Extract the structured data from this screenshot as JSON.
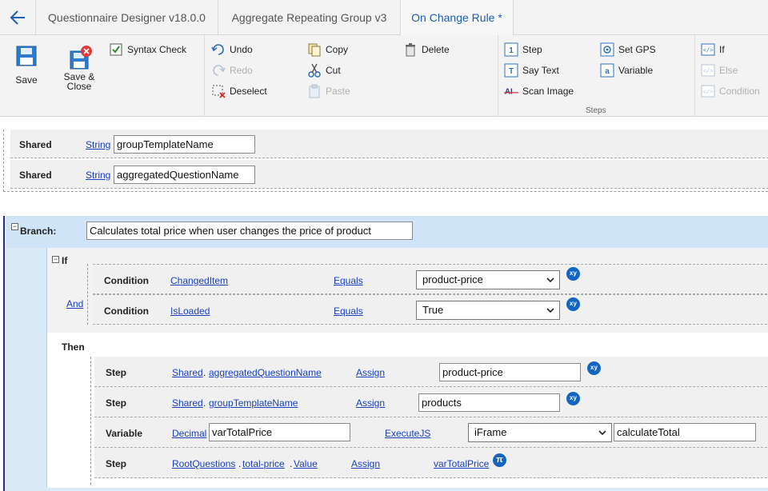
{
  "tabs": [
    {
      "label": "Questionnaire Designer v18.0.0"
    },
    {
      "label": "Aggregate Repeating  Group v3"
    },
    {
      "label": "On Change Rule *"
    }
  ],
  "ribbon": {
    "save": "Save",
    "save_close": "Save & Close",
    "syntax_check": "Syntax Check",
    "undo": "Undo",
    "redo": "Redo",
    "deselect": "Deselect",
    "copy": "Copy",
    "cut": "Cut",
    "paste": "Paste",
    "delete": "Delete",
    "step": "Step",
    "say_text": "Say Text",
    "scan_image": "Scan Image",
    "set_gps": "Set GPS",
    "variable": "Variable",
    "steps_group": "Steps",
    "if": "If",
    "else": "Else",
    "condition": "Condition"
  },
  "shared_rows": [
    {
      "keyword": "Shared",
      "type": "String",
      "name": "groupTemplateName"
    },
    {
      "keyword": "Shared",
      "type": "String",
      "name": "aggregatedQuestionName"
    }
  ],
  "branch": {
    "label": "Branch:",
    "description": "Calculates total price when user changes the price of product",
    "if_label": "If",
    "and_label": "And",
    "then_label": "Then",
    "conditions": [
      {
        "keyword": "Condition",
        "field": "ChangedItem",
        "operator": "Equals",
        "value": "product-price"
      },
      {
        "keyword": "Condition",
        "field": "IsLoaded",
        "operator": "Equals",
        "value": "True"
      }
    ],
    "steps": [
      {
        "keyword": "Step",
        "scope": "Shared",
        "dot": ".",
        "target": "aggregatedQuestionName",
        "action": "Assign",
        "value": "product-price"
      },
      {
        "keyword": "Step",
        "scope": "Shared",
        "dot": ".",
        "target": "groupTemplateName",
        "action": "Assign",
        "value": "products"
      },
      {
        "keyword": "Variable",
        "type": "Decimal",
        "name": "varTotalPrice",
        "action": "ExecuteJS",
        "frame": "iFrame",
        "func": "calculateTotal"
      },
      {
        "keyword": "Step",
        "scope": "RootQuestions",
        "dot": ".",
        "target": "total-price",
        "dot2": ".",
        "prop": "Value",
        "action": "Assign",
        "value": "varTotalPrice"
      }
    ],
    "xy_badge": "xy",
    "pi_badge": "π"
  },
  "colors": {
    "accent": "#1a5fb4",
    "badge": "#1565c0",
    "link": "#1a40c0",
    "branch_bg": "#dbeaf7"
  }
}
